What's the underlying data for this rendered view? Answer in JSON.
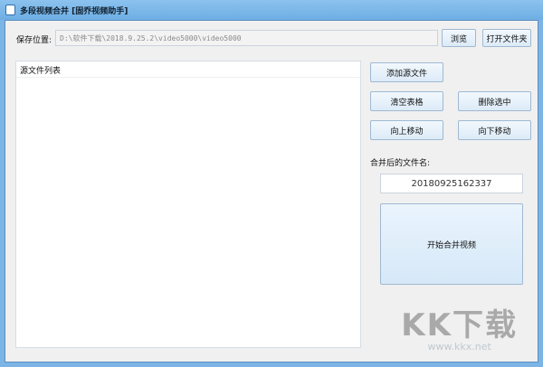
{
  "window": {
    "title": "多段视频合并 [固乔视频助手]"
  },
  "save": {
    "label": "保存位置:",
    "path": "D:\\软件下载\\2018.9.25.2\\video5000\\video5000",
    "browse": "浏览",
    "open_folder": "打开文件夹"
  },
  "list": {
    "header": "源文件列表"
  },
  "buttons": {
    "add": "添加源文件",
    "clear": "清空表格",
    "delete": "删除选中",
    "up": "向上移动",
    "down": "向下移动",
    "start": "开始合并视频"
  },
  "output": {
    "label": "合并后的文件名:",
    "filename": "20180925162337"
  },
  "watermark": {
    "logo": "KK下载",
    "url": "www.kkx.net"
  }
}
